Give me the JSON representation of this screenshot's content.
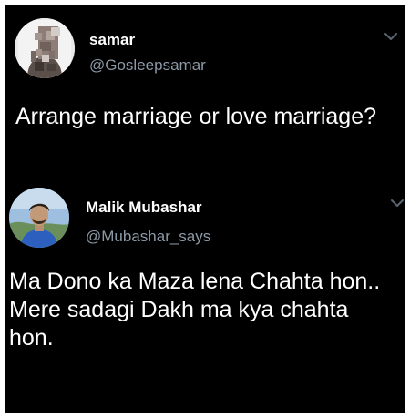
{
  "tweets": [
    {
      "avatar_icon": "user-avatar-blurred",
      "display_name": "samar",
      "handle": "@Gosleepsamar",
      "text": "Arrange marriage or love marriage?",
      "menu_icon": "chevron-down-icon"
    },
    {
      "avatar_icon": "user-avatar-photo",
      "display_name": "Malik Mubashar",
      "handle": "@Mubashar_says",
      "text_lines": [
        "Ma Dono ka Maza lena Chahta hon..",
        "Mere sadagi Dakh ma kya chahta hon."
      ],
      "menu_icon": "chevron-down-icon"
    }
  ],
  "colors": {
    "background": "#000000",
    "name": "#ffffff",
    "handle": "#8b98a5",
    "text": "#ffffff",
    "scroll_indicator": "#2f5f9a"
  }
}
